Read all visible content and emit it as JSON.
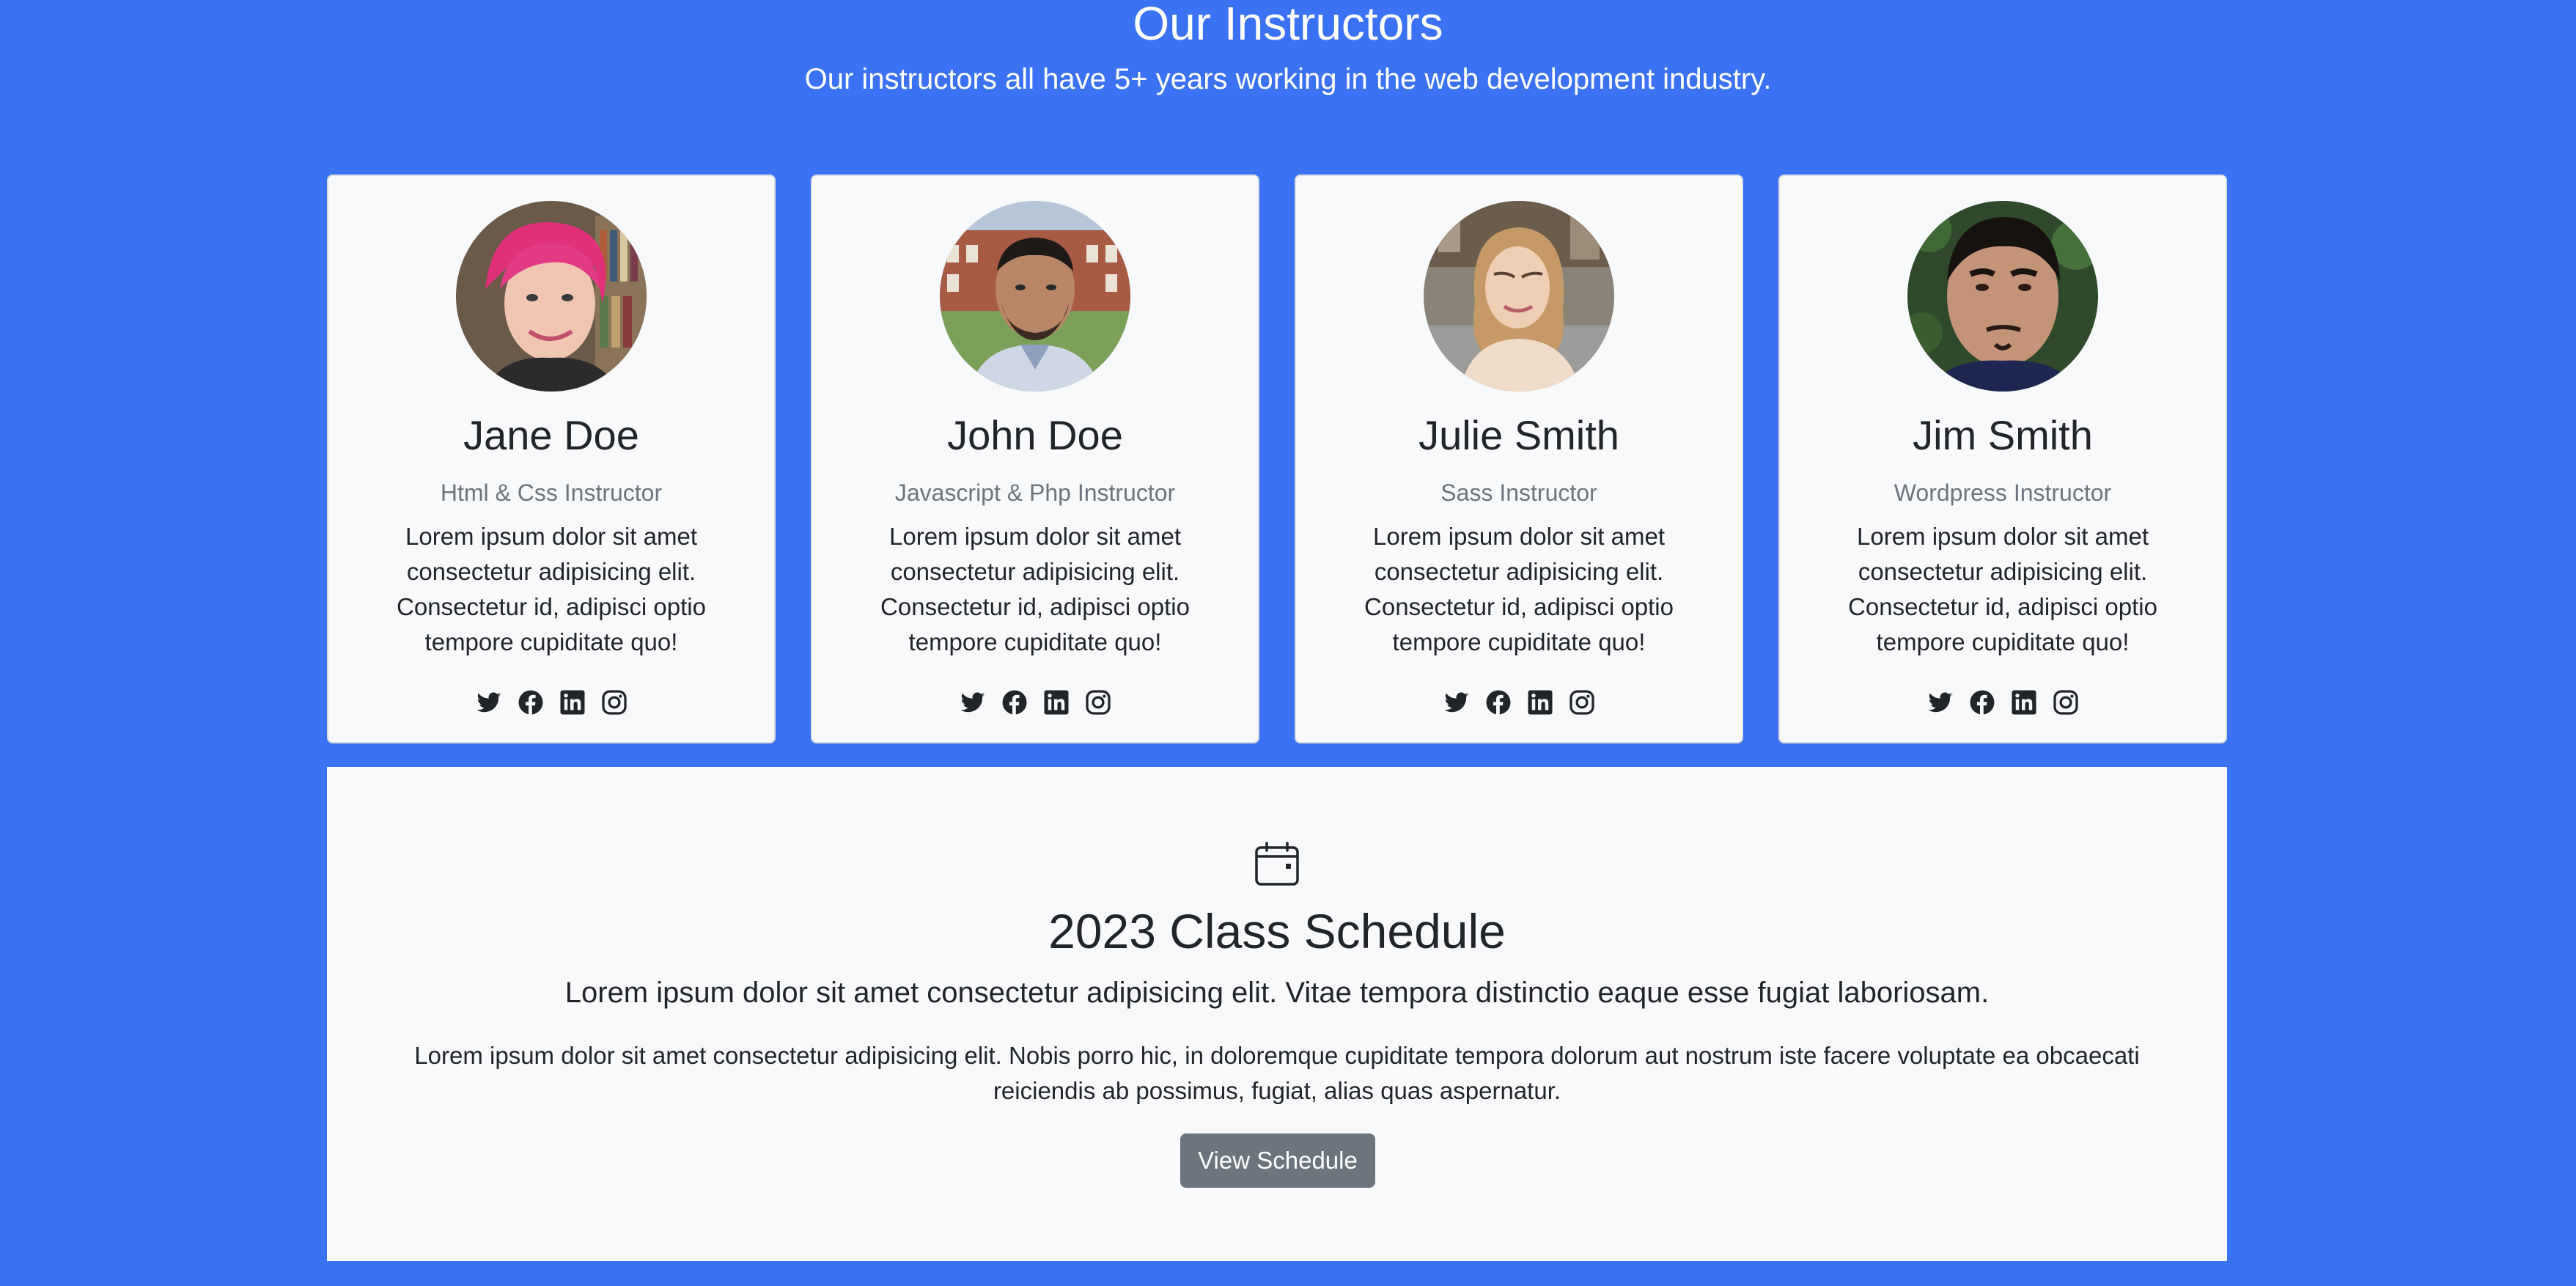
{
  "header": {
    "title": "Our Instructors",
    "subtitle": "Our instructors all have 5+ years working in the web development industry."
  },
  "instructors": [
    {
      "name": "Jane Doe",
      "role": "Html & Css Instructor",
      "bio": "Lorem ipsum dolor sit amet consectetur adipisicing elit. Consectetur id, adipisci optio tempore cupiditate quo!",
      "social": [
        "twitter-icon",
        "facebook-icon",
        "linkedin-icon",
        "instagram-icon"
      ]
    },
    {
      "name": "John Doe",
      "role": "Javascript & Php Instructor",
      "bio": "Lorem ipsum dolor sit amet consectetur adipisicing elit. Consectetur id, adipisci optio tempore cupiditate quo!",
      "social": [
        "twitter-icon",
        "facebook-icon",
        "linkedin-icon",
        "instagram-icon"
      ]
    },
    {
      "name": "Julie Smith",
      "role": "Sass Instructor",
      "bio": "Lorem ipsum dolor sit amet consectetur adipisicing elit. Consectetur id, adipisci optio tempore cupiditate quo!",
      "social": [
        "twitter-icon",
        "facebook-icon",
        "linkedin-icon",
        "instagram-icon"
      ]
    },
    {
      "name": "Jim Smith",
      "role": "Wordpress Instructor",
      "bio": "Lorem ipsum dolor sit amet consectetur adipisicing elit. Consectetur id, adipisci optio tempore cupiditate quo!",
      "social": [
        "twitter-icon",
        "facebook-icon",
        "linkedin-icon",
        "instagram-icon"
      ]
    }
  ],
  "schedule": {
    "icon": "calendar-icon",
    "title": "2023 Class Schedule",
    "lead": "Lorem ipsum dolor sit amet consectetur adipisicing elit. Vitae tempora distinctio eaque esse fugiat laboriosam.",
    "text": "Lorem ipsum dolor sit amet consectetur adipisicing elit. Nobis porro hic, in doloremque cupiditate tempora dolorum aut nostrum iste facere voluptate ea obcaecati reiciendis ab possimus, fugiat, alias quas aspernatur.",
    "button_label": "View Schedule"
  },
  "colors": {
    "page_background": "#3a72f3",
    "card_background": "#f8f9fa",
    "muted_text": "#6c757d",
    "button_background": "#6c757d"
  }
}
